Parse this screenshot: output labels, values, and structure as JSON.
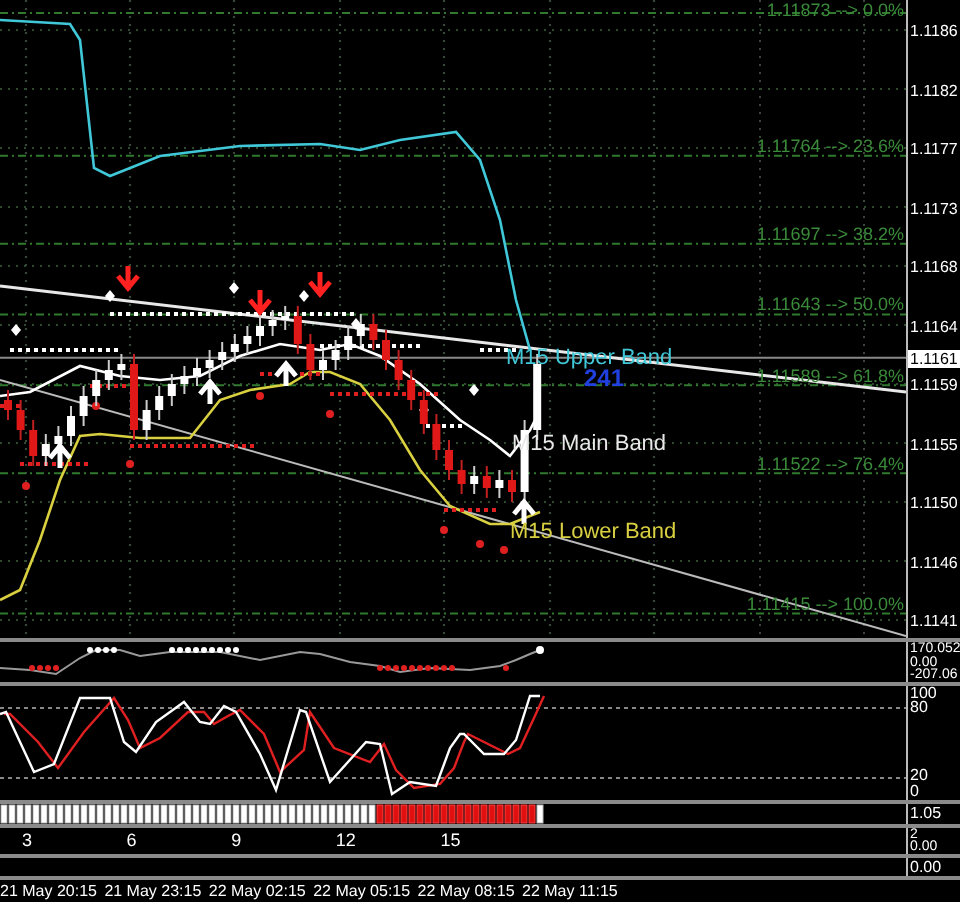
{
  "price_chart": {
    "fib_levels": [
      {
        "label": "1.11873 --> 0.0%"
      },
      {
        "label": "1.11764 --> 23.6%"
      },
      {
        "label": "1.11697 --> 38.2%"
      },
      {
        "label": "1.11643 --> 50.0%"
      },
      {
        "label": "1.11589 --> 61.8%"
      },
      {
        "label": "1.11522 --> 76.4%"
      },
      {
        "label": "1.11415 --> 100.0%"
      }
    ],
    "band_labels": [
      {
        "text": "M15 Upper Band",
        "color": "#40c8d8"
      },
      {
        "text": "M15 Main Band",
        "color": "#e8e8e8"
      },
      {
        "text": "M15 Lower Band",
        "color": "#d8d040"
      }
    ],
    "signal_count": "241",
    "price_axis": [
      "1.1186",
      "1.1182",
      "1.1177",
      "1.1173",
      "1.1168",
      "1.1164",
      "1.1159",
      "1.1155",
      "1.1150",
      "1.1146",
      "1.1141"
    ],
    "current_price": "1.1161"
  },
  "oscillator_panel": {
    "scale": [
      "170.052",
      "0.00",
      "-207.06"
    ]
  },
  "stochastic_panel": {
    "scale": [
      "100",
      "80",
      "20",
      "0"
    ]
  },
  "signal_strip": {
    "scale": [
      "1.05"
    ]
  },
  "index_panel": {
    "labels": [
      "3",
      "6",
      "9",
      "12",
      "15"
    ],
    "scale": [
      "2",
      "0.00"
    ]
  },
  "empty_panel": {
    "scale": [
      "0.00"
    ]
  },
  "time_axis": [
    "21 May 20:15",
    "21 May 23:15",
    "22 May 02:15",
    "22 May 05:15",
    "22 May 08:15",
    "22 May 11:15"
  ]
}
